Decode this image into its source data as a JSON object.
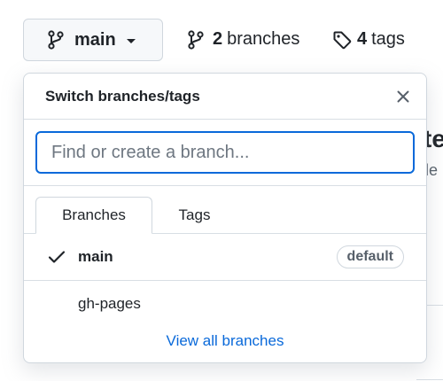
{
  "branch_button": {
    "label": "main"
  },
  "branches_link": {
    "count": "2",
    "label": "branches"
  },
  "tags_link": {
    "count": "4",
    "label": "tags"
  },
  "background": {
    "fragment_1": "te",
    "fragment_2": "le"
  },
  "panel": {
    "title": "Switch branches/tags",
    "search": {
      "placeholder": "Find or create a branch...",
      "value": ""
    },
    "tabs": [
      {
        "label": "Branches",
        "selected": true
      },
      {
        "label": "Tags",
        "selected": false
      }
    ],
    "branches": [
      {
        "name": "main",
        "checked": true,
        "badge": "default"
      },
      {
        "name": "gh-pages",
        "checked": false,
        "badge": ""
      }
    ],
    "view_all_label": "View all branches"
  },
  "colors": {
    "accent": "#0969da",
    "border": "#d0d7de",
    "text": "#1f2328",
    "muted": "#57606a",
    "button_bg": "#f6f8fa"
  },
  "icons": {
    "branch": "git-branch-icon",
    "tag": "tag-icon",
    "caret": "caret-down-icon",
    "close": "close-icon",
    "check": "check-icon"
  }
}
